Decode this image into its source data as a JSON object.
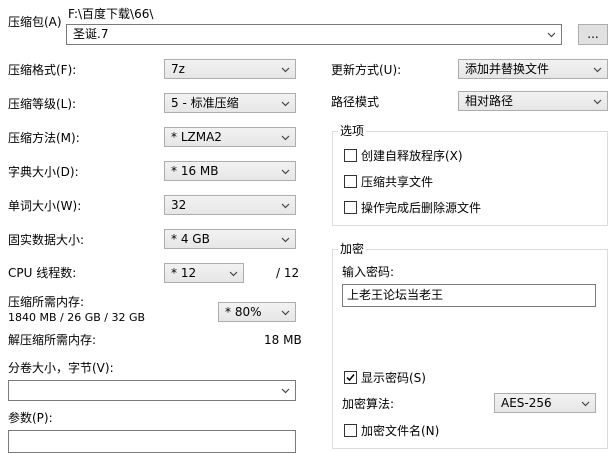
{
  "archive": {
    "label": "压缩包(A)",
    "path": "F:\\百度下载\\66\\",
    "name": "圣诞.7",
    "browse_label": "..."
  },
  "left": {
    "format": {
      "label": "压缩格式(F):",
      "value": "7z"
    },
    "level": {
      "label": "压缩等级(L):",
      "value": "5 - 标准压缩"
    },
    "method": {
      "label": "压缩方法(M):",
      "value": "* LZMA2"
    },
    "dict": {
      "label": "字典大小(D):",
      "value": "* 16 MB"
    },
    "word": {
      "label": "单词大小(W):",
      "value": "32"
    },
    "solid": {
      "label": "固实数据大小:",
      "value": "* 4 GB"
    },
    "threads": {
      "label": "CPU 线程数:",
      "value": "* 12",
      "max": "/ 12"
    },
    "mem_comp": {
      "label": "压缩所需内存:",
      "detail": "1840 MB / 26 GB / 32 GB",
      "value": "* 80%"
    },
    "mem_decomp": {
      "label": "解压缩所需内存:",
      "value": "18 MB"
    },
    "volume": {
      "label": "分卷大小，字节(V):",
      "value": ""
    },
    "params": {
      "label": "参数(P):",
      "value": ""
    }
  },
  "right": {
    "update": {
      "label": "更新方式(U):",
      "value": "添加并替换文件"
    },
    "pathmode": {
      "label": "路径模式",
      "value": "相对路径"
    },
    "options": {
      "title": "选项",
      "sfx": {
        "label": "创建自释放程序(X)",
        "checked": false
      },
      "shared": {
        "label": "压缩共享文件",
        "checked": false
      },
      "delete": {
        "label": "操作完成后删除源文件",
        "checked": false
      }
    },
    "encryption": {
      "title": "加密",
      "password_label": "输入密码:",
      "password_value": "上老王论坛当老王",
      "show_pw": {
        "label": "显示密码(S)",
        "checked": true
      },
      "method_label": "加密算法:",
      "method_value": "AES-256",
      "encrypt_names": {
        "label": "加密文件名(N)",
        "checked": false
      }
    }
  }
}
